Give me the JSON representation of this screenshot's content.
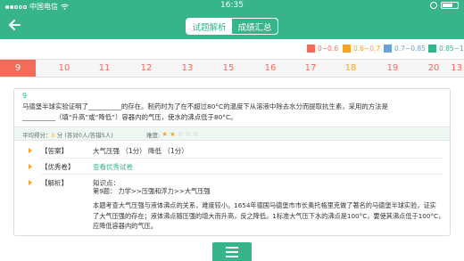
{
  "status_bar": {
    "carrier": "中国电信",
    "time": "16:35"
  },
  "header": {
    "tabs": [
      {
        "label": "试题解析",
        "active": true
      },
      {
        "label": "成绩汇总",
        "active": false
      }
    ]
  },
  "legend": [
    {
      "label": "0~0.6",
      "color": "#f26b5b"
    },
    {
      "label": "0.6~0.7",
      "color": "#f3a52b"
    },
    {
      "label": "0.7~0.85",
      "color": "#6aa2d6"
    },
    {
      "label": "0.85~1",
      "color": "#38b48b"
    }
  ],
  "question_numbers": [
    {
      "n": "9",
      "selected": true,
      "color": "#ffffff"
    },
    {
      "n": "10",
      "selected": false,
      "color": "#f26b5b"
    },
    {
      "n": "11",
      "selected": false,
      "color": "#f26b5b"
    },
    {
      "n": "12",
      "selected": false,
      "color": "#f26b5b"
    },
    {
      "n": "13",
      "selected": false,
      "color": "#f26b5b"
    },
    {
      "n": "15",
      "selected": false,
      "color": "#f26b5b"
    },
    {
      "n": "16",
      "selected": false,
      "color": "#f26b5b"
    },
    {
      "n": "17",
      "selected": false,
      "color": "#f26b5b"
    },
    {
      "n": "18",
      "selected": false,
      "color": "#f3a52b"
    },
    {
      "n": "19",
      "selected": false,
      "color": "#f26b5b"
    },
    {
      "n": "20",
      "selected": false,
      "color": "#f26b5b"
    },
    {
      "n": "13",
      "selected": false,
      "color": "#f26b5b"
    }
  ],
  "question": {
    "number": "9",
    "text_line1": "马德堡半球实验证明了__________的存在。制药时为了在不超过80°C的温度下从溶液中除去水分而提取抗生素，采用的方法是",
    "text_line2": "__________（填“升高”或“降低”）容器内的气压，使水的沸点低于80°C。",
    "avg_label": "平均得分：",
    "avg_value": "0",
    "avg_unit": "分",
    "avg_detail": "(答对0人/答错5人)",
    "difficulty_label": "难度:",
    "difficulty_stars": 2,
    "difficulty_max": 5
  },
  "answer": {
    "label": "【答案】",
    "value": "大气压强  （1分）   降低  （1分）"
  },
  "excellent": {
    "label": "【优秀卷】",
    "link": "查看优秀试卷"
  },
  "analysis": {
    "label": "【解析】",
    "kp_title": "知识点：",
    "kp_value": "第9题：  力学>>压强和浮力>>大气压强",
    "para_line1": "本题考查大气压强与液体沸点的关系，难度较小。1654年德国马德堡市市长奥托格里克做了著名的马德堡半球实验，证实",
    "para_line2": "了大气压强的存在；液体沸点随压强的增大而升高，反之降低。1标准大气压下水的沸点是100°C，要使其沸点低于100°C，",
    "para_line3": "应降低容器内的气压。"
  }
}
